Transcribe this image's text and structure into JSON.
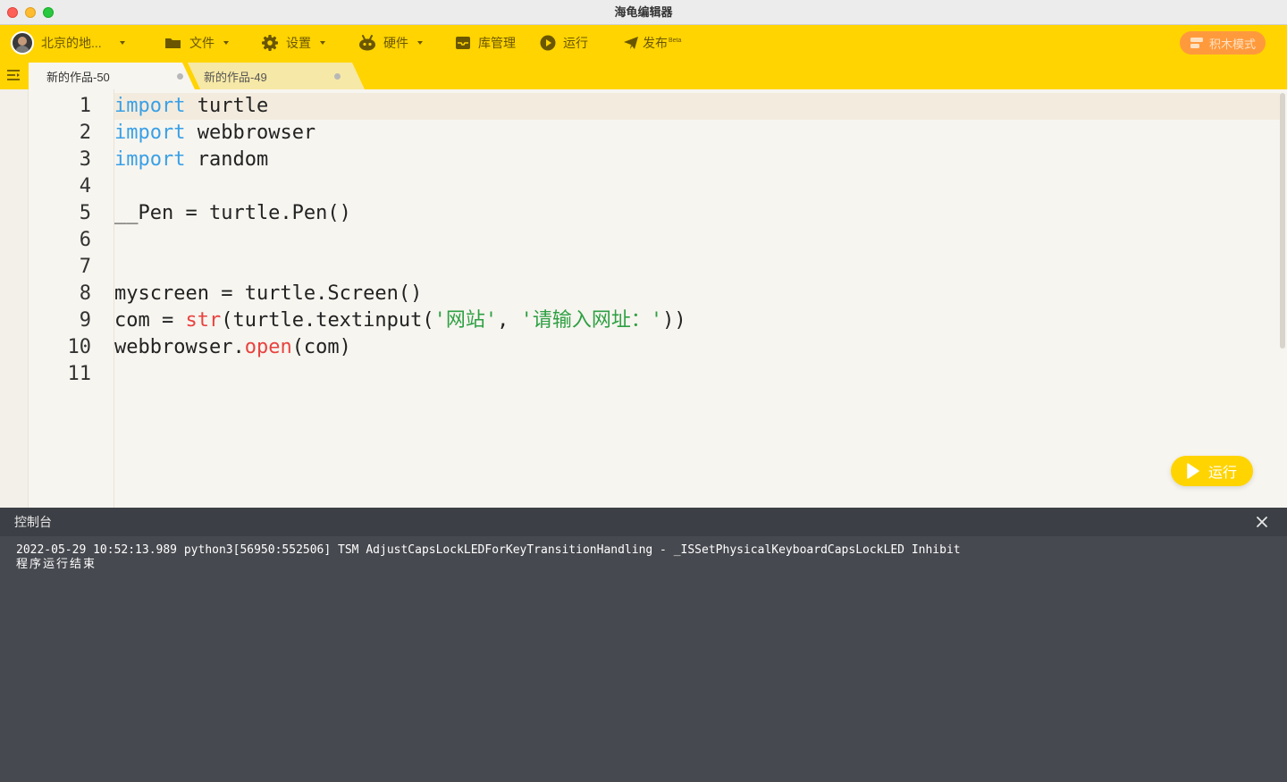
{
  "window": {
    "title": "海龟编辑器"
  },
  "toolbar": {
    "user": "北京的地...",
    "file": "文件",
    "settings": "设置",
    "hardware": "硬件",
    "library": "库管理",
    "run": "运行",
    "publish": "发布",
    "publish_badge": "Beta",
    "block_mode": "积木模式"
  },
  "tabs": [
    {
      "label": "新的作品-50",
      "active": true
    },
    {
      "label": "新的作品-49",
      "active": false
    }
  ],
  "editor": {
    "line_numbers": [
      "1",
      "2",
      "3",
      "4",
      "5",
      "6",
      "7",
      "8",
      "9",
      "10",
      "11"
    ],
    "run_button": "运行"
  },
  "console": {
    "title": "控制台",
    "lines": [
      "2022-05-29 10:52:13.989 python3[56950:552506] TSM AdjustCapsLockLEDForKeyTransitionHandling - _ISSetPhysicalKeyboardCapsLockLED Inhibit",
      "程序运行结束"
    ]
  },
  "colors": {
    "toolbar_bg": "#ffd400",
    "keyword": "#3aa0e6",
    "builtin": "#e8433f",
    "string": "#2ea043",
    "block_mode_button": "#ff9a3c",
    "console_bg": "#46494f"
  },
  "code": {
    "l1_kw": "import",
    "l1_rest": " turtle",
    "l2_kw": "import",
    "l2_rest": " webbrowser",
    "l3_kw": "import",
    "l3_rest": " random",
    "l5": "__Pen = turtle.Pen()",
    "l8": "myscreen = turtle.Screen()",
    "l9_a": "com = ",
    "l9_b": "str",
    "l9_c": "(turtle.textinput(",
    "l9_d": "'网站'",
    "l9_e": ", ",
    "l9_f": "'请输入网址：'",
    "l9_g": "))",
    "l10_a": "webbrowser.",
    "l10_b": "open",
    "l10_c": "(com)"
  }
}
